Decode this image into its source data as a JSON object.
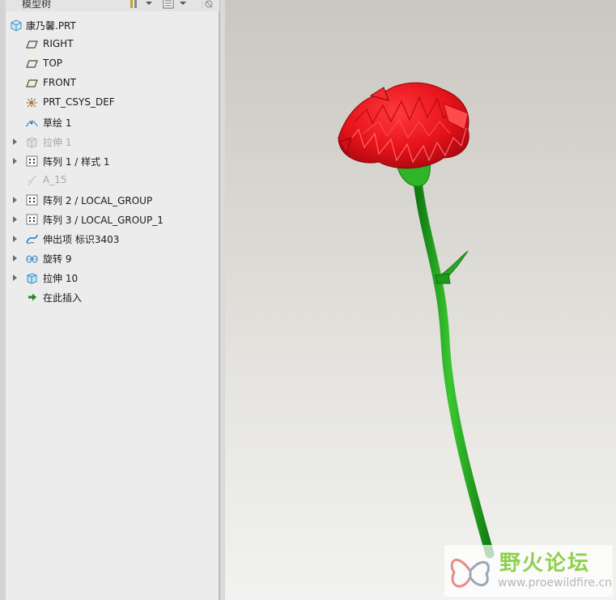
{
  "panel": {
    "title": "模型树"
  },
  "tree": {
    "root": "康乃馨.PRT",
    "items": [
      {
        "label": "RIGHT",
        "icon": "datum-plane-icon",
        "expandable": false,
        "dim": false
      },
      {
        "label": "TOP",
        "icon": "datum-plane-icon",
        "expandable": false,
        "dim": false
      },
      {
        "label": "FRONT",
        "icon": "datum-plane-icon",
        "expandable": false,
        "dim": false
      },
      {
        "label": "PRT_CSYS_DEF",
        "icon": "coordinate-system-icon",
        "expandable": false,
        "dim": false
      },
      {
        "label": "草绘 1",
        "icon": "sketch-icon",
        "expandable": false,
        "dim": false
      },
      {
        "label": "拉伸 1",
        "icon": "extrude-icon",
        "expandable": true,
        "dim": true
      },
      {
        "label": "阵列 1 / 样式 1",
        "icon": "pattern-icon",
        "expandable": true,
        "dim": false
      },
      {
        "label": "A_15",
        "icon": "datum-axis-icon",
        "expandable": false,
        "dim": true
      },
      {
        "label": "阵列 2 / LOCAL_GROUP",
        "icon": "pattern-icon",
        "expandable": true,
        "dim": false
      },
      {
        "label": "阵列 3 / LOCAL_GROUP_1",
        "icon": "pattern-icon",
        "expandable": true,
        "dim": false
      },
      {
        "label": "伸出项 标识3403",
        "icon": "sweep-icon",
        "expandable": true,
        "dim": false
      },
      {
        "label": "旋转 9",
        "icon": "revolve-icon",
        "expandable": true,
        "dim": false
      },
      {
        "label": "拉伸 10",
        "icon": "extrude-icon",
        "expandable": true,
        "dim": false
      },
      {
        "label": "在此插入",
        "icon": "insert-here-arrow-icon",
        "expandable": false,
        "dim": false
      }
    ]
  },
  "watermark": {
    "title": "野火论坛",
    "url": "www.proewildfire.cn"
  },
  "colors": {
    "flower_red": "#e8141a",
    "stem_green": "#26a51f",
    "watermark_green": "#8fd14f"
  }
}
